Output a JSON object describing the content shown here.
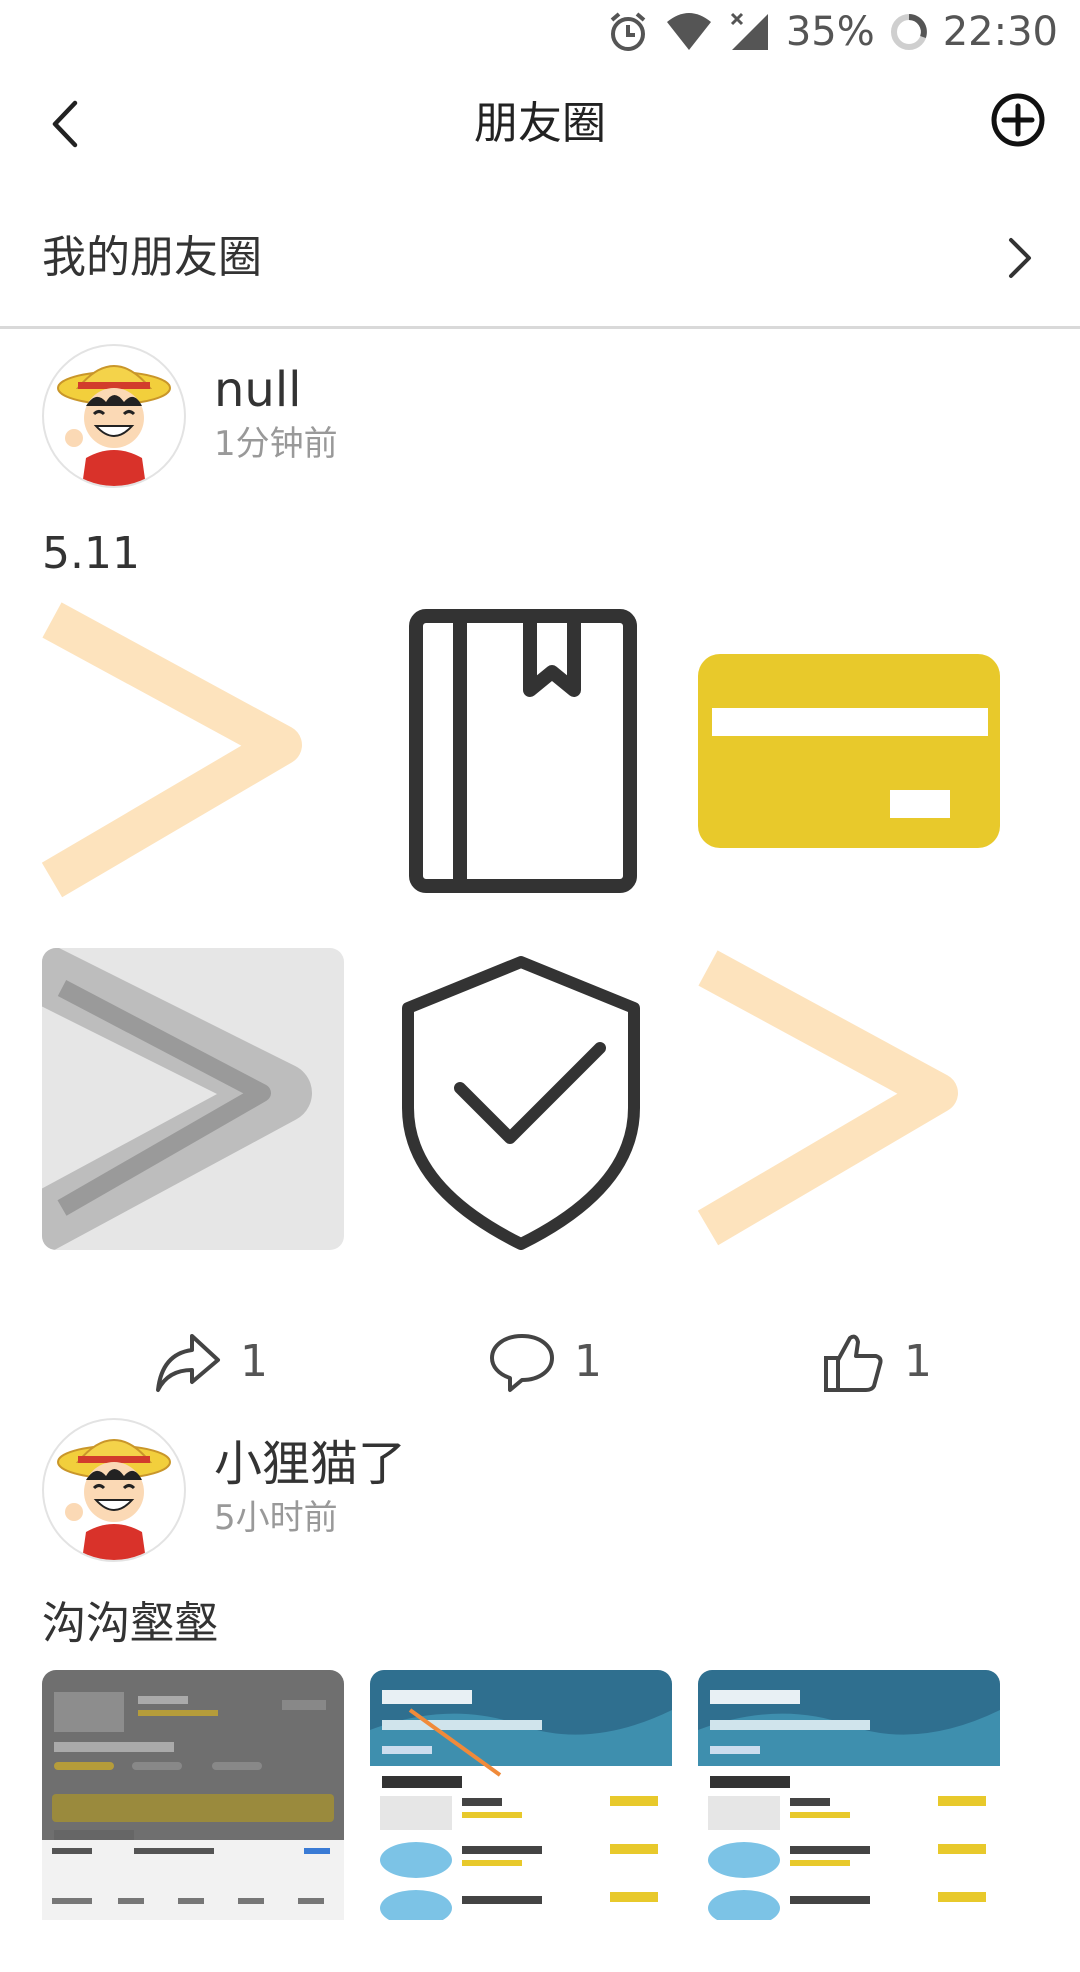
{
  "status_bar": {
    "battery": "35%",
    "time": "22:30",
    "icons": [
      "alarm-icon",
      "wifi-icon",
      "signal-icon",
      "battery-icon"
    ]
  },
  "nav": {
    "title": "朋友圈",
    "back_icon": "chevron-left-icon",
    "add_icon": "plus-circle-icon"
  },
  "my_moments": {
    "label": "我的朋友圈",
    "icon": "chevron-right-icon"
  },
  "posts": [
    {
      "author": "null",
      "time": "1分钟前",
      "content": "5.11",
      "images": [
        "arrow-right-orange",
        "book-icon",
        "card-icon",
        "arrow-right-gray",
        "shield-check-icon",
        "arrow-right-orange"
      ],
      "share_count": "1",
      "comment_count": "1",
      "like_count": "1"
    },
    {
      "author": "小狸猫了",
      "time": "5小时前",
      "content": "沟沟壑壑",
      "images": [
        "app-screenshot",
        "app-screenshot",
        "app-screenshot"
      ]
    }
  ],
  "colors": {
    "accent_yellow": "#e8c92b",
    "orange_light": "#f7c98a",
    "divider": "#d9d9d9"
  }
}
